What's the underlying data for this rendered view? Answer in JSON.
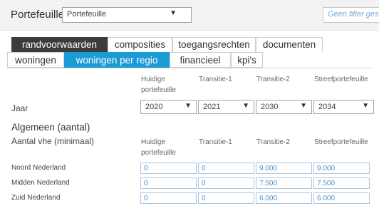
{
  "header": {
    "portfolio_label": "Portefeuille",
    "portfolio_value": "Portefeuille",
    "filter_placeholder": "Geen filter geselecteerd"
  },
  "tabs_main": [
    {
      "label": "randvoorwaarden",
      "active": true
    },
    {
      "label": "composities",
      "active": false
    },
    {
      "label": "toegangsrechten",
      "active": false
    },
    {
      "label": "documenten",
      "active": false
    }
  ],
  "tabs_sub": [
    {
      "label": "woningen",
      "active": false
    },
    {
      "label": "woningen per regio",
      "active": true
    },
    {
      "label": "financieel",
      "active": false
    },
    {
      "label": "kpi's",
      "active": false
    }
  ],
  "columns": {
    "huidige": "Huidige\nportefeuille",
    "transitie1": "Transitie-1",
    "transitie2": "Transitie-2",
    "streef": "Streefportefeuille"
  },
  "jaar": {
    "label": "Jaar",
    "values": [
      "2020",
      "2021",
      "2030",
      "2034"
    ]
  },
  "section_title": "Algemeen (aantal)",
  "subsection_title": "Aantal vhe (minimaal)",
  "rows": [
    {
      "label": "Noord Nederland",
      "values": [
        "0",
        "0",
        "9.000",
        "9.000"
      ]
    },
    {
      "label": "Midden Nederland",
      "values": [
        "0",
        "0",
        "7.500",
        "7.500"
      ]
    },
    {
      "label": "Zuid Nederland",
      "values": [
        "0",
        "0",
        "6.000",
        "6.000"
      ]
    }
  ],
  "colors": {
    "active_main_tab": "#3c3c3c",
    "active_sub_tab": "#1c9ad6",
    "input_text": "#4a90c8"
  },
  "icons": [
    "chevron-down-icon"
  ]
}
